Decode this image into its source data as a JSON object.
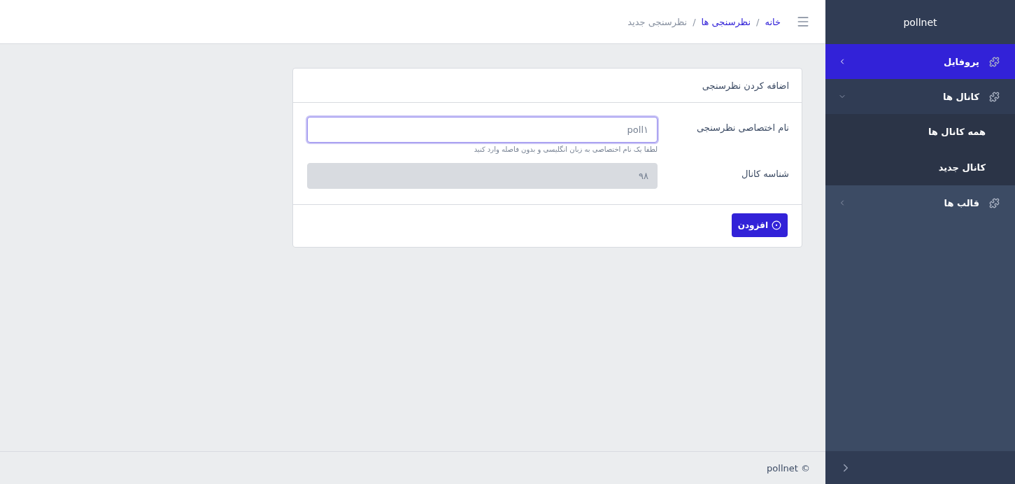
{
  "sidebar": {
    "brand": "pollnet",
    "items": [
      {
        "label": "پروفایل",
        "selected": true,
        "expanded": false
      },
      {
        "label": "کانال ها",
        "selected": false,
        "expanded": true,
        "children": [
          {
            "label": "همه کانال ها",
            "selected": false
          },
          {
            "label": "کانال جدید",
            "selected": false
          }
        ]
      },
      {
        "label": "قالب ها",
        "selected": false,
        "expanded": false
      }
    ]
  },
  "breadcrumb": [
    {
      "kind": "link",
      "label": "خانه"
    },
    {
      "kind": "separator",
      "label": "/"
    },
    {
      "kind": "link",
      "label": "نظرسنجی ها"
    },
    {
      "kind": "separator",
      "label": "/"
    },
    {
      "kind": "current",
      "label": "نظرسنجی جدید"
    }
  ],
  "card": {
    "title": "اضافه کردن نظرسنجی",
    "fields": [
      {
        "label": "نام اختصاصی نظرسنجی",
        "value": "poll۱",
        "hint": "لطفا یک نام اختصاصی به زبان انگلیسی و بدون فاصله وارد کنید",
        "disabled": false,
        "focused": true
      },
      {
        "label": "شناسه کانال",
        "value": "۹۸",
        "disabled": true,
        "focused": false
      }
    ],
    "button": "افزودن"
  },
  "footer": "pollnet ©"
}
